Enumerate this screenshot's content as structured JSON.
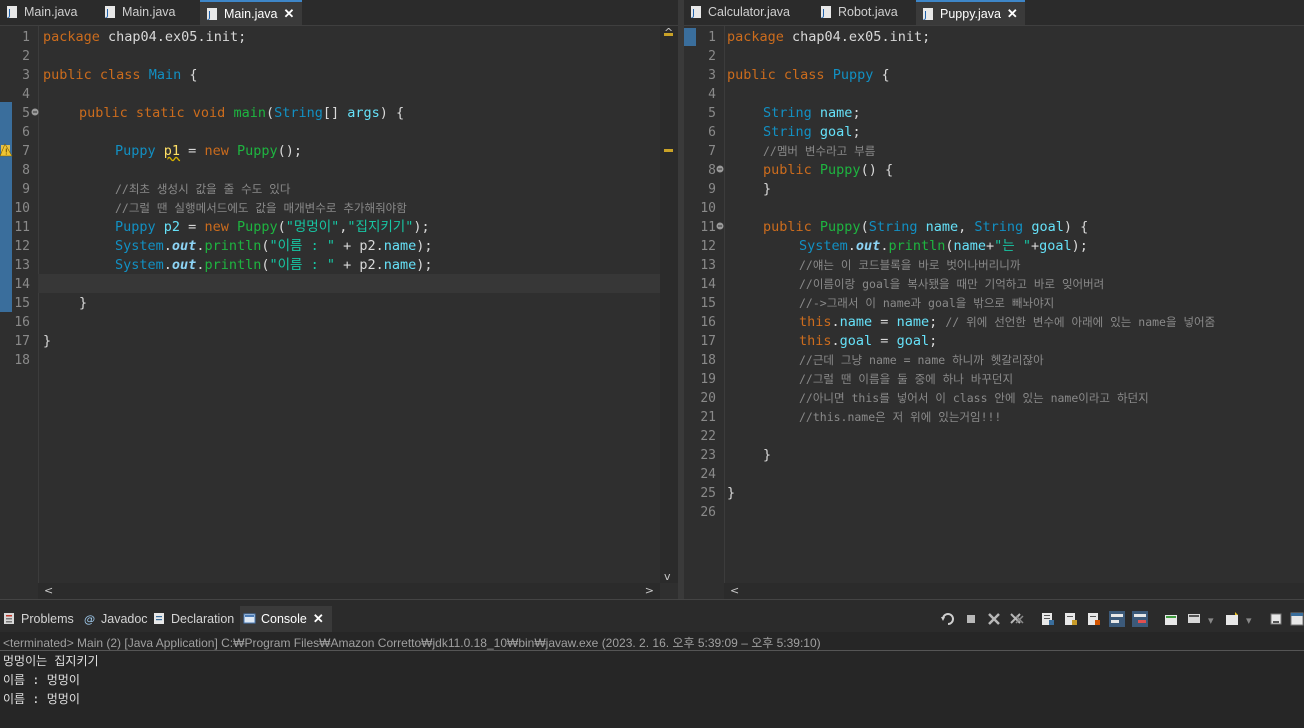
{
  "left_editor": {
    "tabs": [
      {
        "label": "Main.java",
        "active": false
      },
      {
        "label": "Main.java",
        "active": false
      },
      {
        "label": "Main.java",
        "active": true
      }
    ],
    "close_glyph": "✕",
    "line_numbers": [
      "1",
      "2",
      "3",
      "4",
      "5",
      "6",
      "7",
      "8",
      "9",
      "10",
      "11",
      "12",
      "13",
      "14",
      "15",
      "16",
      "17",
      "18"
    ],
    "code": {
      "l1_kw": "package",
      "l1_rest": " chap04.ex05.init;",
      "l3_kw": "public class",
      "l3_cls": "Main",
      "l3_rest": " {",
      "l5_kw": "public static void",
      "l5_fn": "main",
      "l5_p1": "(",
      "l5_cls": "String",
      "l5_p2": "[] ",
      "l5_var": "args",
      "l5_p3": ") {",
      "l7_cls": "Puppy",
      "l7_var": "p1",
      "l7_eq": " = ",
      "l7_kw": "new",
      "l7_fn": "Puppy",
      "l7_rest": "();",
      "l9_cm": "//최초 생성시 값을 줄 수도 있다",
      "l10_cm": "//그럴 땐 실행메서드에도 값을 매개변수로 추가해줘야함",
      "l11_cls": "Puppy",
      "l11_var": "p2",
      "l11_eq": " = ",
      "l11_kw": "new",
      "l11_fn": "Puppy",
      "l11_p1": "(",
      "l11_s1": "\"멍멍이\"",
      "l11_c": ",",
      "l11_s2": "\"집지키기\"",
      "l11_p2": ");",
      "l12_cls": "System",
      "l12_dot1": ".",
      "l12_out": "out",
      "l12_dot2": ".",
      "l12_fn": "println",
      "l12_p1": "(",
      "l12_str": "\"이름 : \"",
      "l12_plus": " + p2.",
      "l12_fld": "name",
      "l12_p2": ");",
      "l13_cls": "System",
      "l13_dot1": ".",
      "l13_out": "out",
      "l13_dot2": ".",
      "l13_fn": "println",
      "l13_p1": "(",
      "l13_str": "\"이름 : \"",
      "l13_plus": " + p2.",
      "l13_fld": "name",
      "l13_p2": ");",
      "l15_rest": "}",
      "l17_rest": "}"
    }
  },
  "right_editor": {
    "tabs": [
      {
        "label": "Calculator.java",
        "active": false
      },
      {
        "label": "Robot.java",
        "active": false
      },
      {
        "label": "Puppy.java",
        "active": true
      }
    ],
    "close_glyph": "✕",
    "line_numbers": [
      "1",
      "2",
      "3",
      "4",
      "5",
      "6",
      "7",
      "8",
      "9",
      "10",
      "11",
      "12",
      "13",
      "14",
      "15",
      "16",
      "17",
      "18",
      "19",
      "20",
      "21",
      "22",
      "23",
      "24",
      "25",
      "26"
    ],
    "code": {
      "l1_kw": "package",
      "l1_rest": " chap04.ex05.init;",
      "l3_kw": "public class",
      "l3_cls": "Puppy",
      "l3_rest": " {",
      "l5_cls": "String",
      "l5_fld": "name",
      "l5_rest": ";",
      "l6_cls": "String",
      "l6_fld": "goal",
      "l6_rest": ";",
      "l7_cm": "//멤버 변수라고 부름",
      "l8_kw": "public",
      "l8_fn": "Puppy",
      "l8_rest": "() {",
      "l9_rest": "}",
      "l11_kw": "public",
      "l11_fn": "Puppy",
      "l11_p1": "(",
      "l11_cls1": "String",
      "l11_v1": "name",
      "l11_c": ", ",
      "l11_cls2": "String",
      "l11_v2": "goal",
      "l11_p2": ") {",
      "l12_cls": "System",
      "l12_dot1": ".",
      "l12_out": "out",
      "l12_dot2": ".",
      "l12_fn": "println",
      "l12_p1": "(",
      "l12_v1": "name",
      "l12_plus1": "+",
      "l12_str": "\"는 \"",
      "l12_plus2": "+",
      "l12_v2": "goal",
      "l12_p2": ");",
      "l13_cm": "//얘는 이 코드블록을 바로 벗어나버리니까",
      "l14_cm": "//이름이랑 goal을 복사됐을 때만 기억하고 바로 잊어버려",
      "l15_cm": "//->그래서 이 name과 goal을 밖으로 빼놔야지",
      "l16_kw": "this",
      "l16_dot": ".",
      "l16_fld": "name",
      "l16_eq": " = ",
      "l16_v": "name",
      "l16_semi": "; ",
      "l16_cm": "// 위에 선언한 변수에 아래에 있는 name을 넣어줌",
      "l17_kw": "this",
      "l17_dot": ".",
      "l17_fld": "goal",
      "l17_eq": " = ",
      "l17_v": "goal",
      "l17_semi": ";",
      "l18_cm": "//근데 그냥 name = name 하니까 헷갈리잖아",
      "l19_cm": "//그럴 땐 이름을 둘 중에 하나 바꾸던지",
      "l20_cm": "//아니면 this를 넣어서 이 class 안에 있는 name이라고 하던지",
      "l21_cm": "//this.name은 저 위에 있는거임!!!",
      "l23_rest": "}",
      "l25_rest": "}"
    }
  },
  "views": {
    "tabs": [
      {
        "label": "Problems",
        "icon": "problems-icon"
      },
      {
        "label": "Javadoc",
        "icon": "javadoc-icon"
      },
      {
        "label": "Declaration",
        "icon": "declaration-icon"
      },
      {
        "label": "Console",
        "icon": "console-icon",
        "active": true
      }
    ],
    "close_glyph": "✕",
    "console_status": "<terminated> Main (2) [Java Application] C:₩Program Files₩Amazon Corretto₩jdk11.0.18_10₩bin₩javaw.exe  (2023. 2. 16. 오후 5:39:09 – 오후 5:39:10)",
    "console_output": [
      "멍멍이는 집지키기",
      "이름 : 멍멍이",
      "이름 : 멍멍이"
    ],
    "toolbar_icons": [
      "pin-icon",
      "terminate-icon",
      "remove-launch-icon",
      "remove-all-terminated-icon",
      "scroll-lock-icon",
      "word-wrap-icon",
      "show-on-stdout-icon",
      "show-on-stderr-icon",
      "clear-console-icon",
      "open-console-icon",
      "display-selected-console-icon",
      "new-console-icon",
      "minimize-icon",
      "maximize-icon"
    ]
  }
}
